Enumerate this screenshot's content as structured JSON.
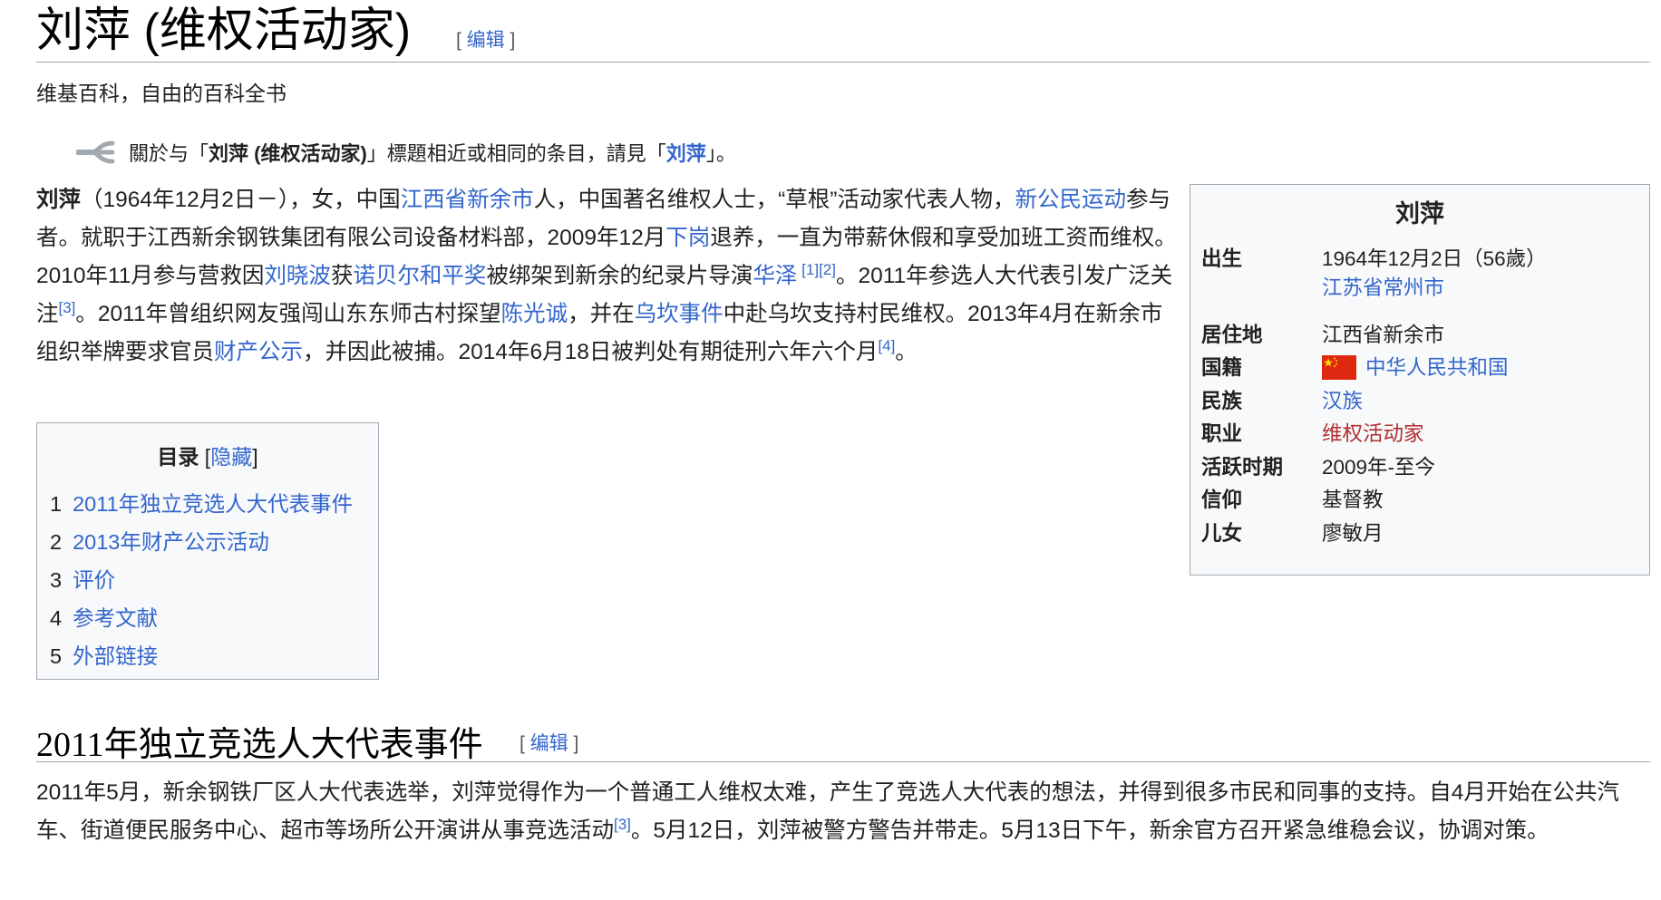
{
  "title": "刘萍 (维权活动家)",
  "edit": {
    "open": "[ ",
    "label": "编辑",
    "close": " ]"
  },
  "tagline": "维基百科，自由的百科全书",
  "hatnote": {
    "p1": "關於与「",
    "bold": "刘萍 (维权活动家)",
    "p2": "」標題相近或相同的条目，請見「",
    "link": "刘萍",
    "p3": "」。"
  },
  "lead": {
    "name": "刘萍",
    "t1": "（1964年12月2日－），女，中国",
    "l1": "江西省新余市",
    "t2": "人，中国著名维权人士，“草根”活动家代表人物，",
    "l2": "新公民运动",
    "t3": "参与者。就职于江西新余钢铁集团有限公司设备材料部，2009年12月",
    "l3": "下岗",
    "t4": "退养，一直为带薪休假和享受加班工资而维权。2010年11月参与营救因",
    "l4": "刘晓波",
    "t5": "获",
    "l5": "诺贝尔和平奖",
    "t6": "被绑架到新余的纪录片导演",
    "l6": "华泽",
    "r1": "[1]",
    "r2": "[2]",
    "t7": "。2011年参选人大代表引发广泛关注",
    "r3": "[3]",
    "t8": "。2011年曾组织网友强闯山东东师古村探望",
    "l7": "陈光诚",
    "t9": "，并在",
    "l8": "乌坎事件",
    "t10": "中赴乌坎支持村民维权。2013年4月在新余市组织举牌要求官员",
    "l9": "财产公示",
    "t11": "，并因此被捕。2014年6月18日被判处有期徒刑六年六个月",
    "r4": "[4]",
    "t12": "。"
  },
  "infobox": {
    "title": "刘萍",
    "born_label": "出生",
    "born_value": "1964年12月2日（56歲）",
    "born_place": "江苏省常州市",
    "residence_label": "居住地",
    "residence_value": "江西省新余市",
    "nationality_label": "国籍",
    "nationality_value": "中华人民共和国",
    "ethnicity_label": "民族",
    "ethnicity_value": "汉族",
    "occupation_label": "职业",
    "occupation_value": "维权活动家",
    "active_label": "活跃时期",
    "active_value": "2009年-至今",
    "religion_label": "信仰",
    "religion_value": "基督教",
    "children_label": "儿女",
    "children_value": "廖敏月"
  },
  "toc": {
    "title": "目录",
    "hide_open": " [",
    "hide": "隐藏",
    "hide_close": "]",
    "items": [
      {
        "num": "1",
        "label": "2011年独立竞选人大代表事件"
      },
      {
        "num": "2",
        "label": "2013年财产公示活动"
      },
      {
        "num": "3",
        "label": "评价"
      },
      {
        "num": "4",
        "label": "参考文献"
      },
      {
        "num": "5",
        "label": "外部链接"
      }
    ]
  },
  "section1": {
    "title": "2011年独立竞选人大代表事件",
    "p1": "2011年5月，新余钢铁厂区人大代表选举，刘萍觉得作为一个普通工人维权太难，产生了竞选人大代表的想法，并得到很多市民和同事的支持。自4月开始在公共汽车、街道便民服务中心、超市等场所公开演讲从事竞选活动",
    "ref": "[3]",
    "p2": "。5月12日，刘萍被警方警告并带走。5月13日下午，新余官方召开紧急维稳会议，协调对策。"
  },
  "colors": {
    "link": "#3366cc",
    "redlink": "#b02e2e",
    "border": "#a2a9b1",
    "box_bg": "#f8f9fa",
    "flag_red": "#de2910",
    "flag_star": "#ffde00"
  }
}
